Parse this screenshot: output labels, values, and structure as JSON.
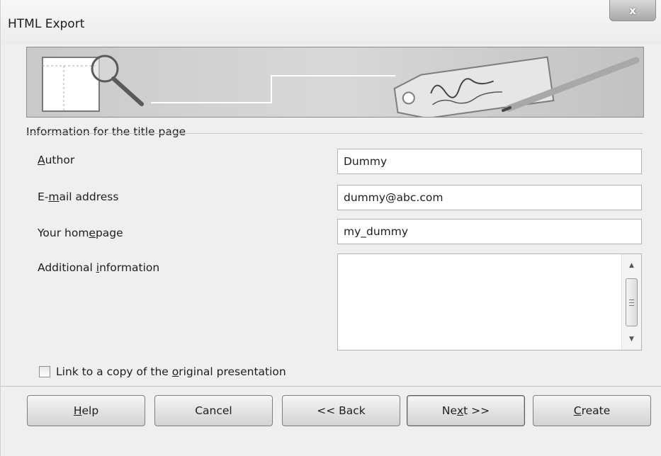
{
  "window": {
    "title": "HTML Export",
    "close_glyph": "x"
  },
  "section": {
    "title": "Information for the title page"
  },
  "fields": {
    "author": {
      "label_pre": "",
      "label_u": "A",
      "label_post": "uthor",
      "value": "Dummy"
    },
    "email": {
      "label_pre": "E-",
      "label_u": "m",
      "label_post": "ail address",
      "value": "dummy@abc.com"
    },
    "homepage": {
      "label_pre": "Your hom",
      "label_u": "e",
      "label_post": "page",
      "value": "my_dummy"
    },
    "additional": {
      "label_pre": "Additional ",
      "label_u": "i",
      "label_post": "nformation",
      "value": ""
    }
  },
  "checkbox": {
    "label_pre": "Link to a copy of the ",
    "label_u": "o",
    "label_post": "riginal presentation",
    "checked": false
  },
  "buttons": {
    "help": {
      "pre": "",
      "u": "H",
      "post": "elp"
    },
    "cancel": {
      "pre": "Cancel",
      "u": "",
      "post": ""
    },
    "back": {
      "pre": "<< Back",
      "u": "",
      "post": ""
    },
    "next": {
      "pre": "Ne",
      "u": "x",
      "post": "t >>"
    },
    "create": {
      "pre": "",
      "u": "C",
      "post": "reate"
    }
  },
  "icons": {
    "banner": "html-export-banner-illustration",
    "scroll_up": "scroll-up-arrow-icon",
    "scroll_down": "scroll-down-arrow-icon"
  }
}
